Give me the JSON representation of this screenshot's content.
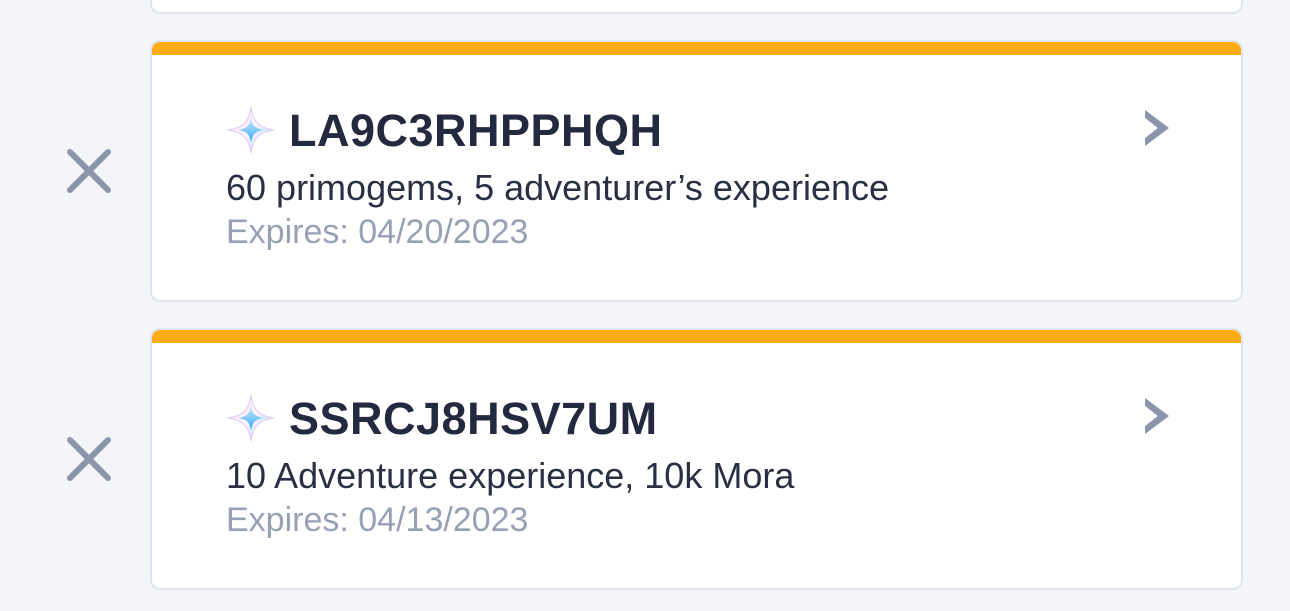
{
  "colors": {
    "page_background": "#f3f5f9",
    "card_background": "#ffffff",
    "card_border": "#dfe4ee",
    "accent": "#fdac16",
    "code_text": "#23293f",
    "reward_text": "#2a2f43",
    "expiry_text": "#97a0b4",
    "icon_gray": "#8c95ab"
  },
  "codes": [
    {
      "code": "LA9C3RHPPHQH",
      "rewards": "60 primogems, 5 adventurer’s experience",
      "expires": "Expires: 04/20/2023",
      "icon": "primogem-star-icon",
      "dismiss_icon": "close-icon",
      "open_icon": "chevron-right-icon"
    },
    {
      "code": "SSRCJ8HSV7UM",
      "rewards": "10 Adventure experience, 10k Mora",
      "expires": "Expires: 04/13/2023",
      "icon": "primogem-star-icon",
      "dismiss_icon": "close-icon",
      "open_icon": "chevron-right-icon"
    }
  ]
}
